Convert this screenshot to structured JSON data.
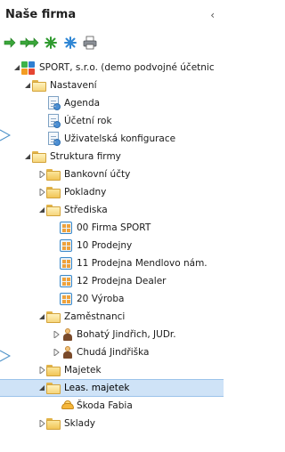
{
  "header": {
    "title": "Naše firma",
    "collapse_glyph": "‹"
  },
  "toolbar": {
    "buttons": [
      {
        "name": "expand-arrow-icon",
        "glyph": "➜"
      },
      {
        "name": "expand-all-arrows-icon",
        "glyph": "➜➜"
      },
      {
        "name": "expand-star-icon",
        "glyph": "✲"
      },
      {
        "name": "collapse-star-icon",
        "glyph": "✲"
      },
      {
        "name": "print-icon",
        "glyph": "⎙"
      }
    ]
  },
  "tree": {
    "root": "SPORT, s.r.o. (demo podvojné účetnic",
    "nastaveni": "Nastavení",
    "agenda": "Agenda",
    "ucetni_rok": "Účetní rok",
    "uzivatelska": "Uživatelská konfigurace",
    "struktura": "Struktura firmy",
    "bankovni": "Bankovní účty",
    "pokladny": "Pokladny",
    "strediska": "Střediska",
    "s00": "00 Firma SPORT",
    "s10": "10 Prodejny",
    "s11": "11 Prodejna Mendlovo nám.",
    "s12": "12 Prodejna Dealer",
    "s20": "20 Výroba",
    "zamestnanci": "Zaměstnanci",
    "bohaty": "Bohatý Jindřich, JUDr.",
    "chuda": "Chudá Jindřiška",
    "majetek": "Majetek",
    "leas": "Leas. majetek",
    "skoda": "Škoda Fabia",
    "sklady": "Sklady"
  },
  "colors": {
    "selection": "#cfe3f7",
    "folder": "#f1c557",
    "accent": "#3a88c9"
  }
}
